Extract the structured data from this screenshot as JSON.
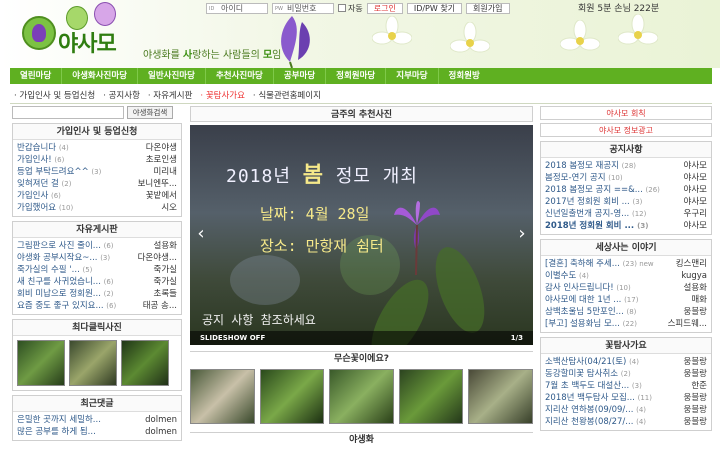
{
  "header": {
    "logo": "야사모",
    "tagline_parts": [
      "야생화를 ",
      "사",
      "랑하는 사람들의 ",
      "모",
      "임"
    ],
    "login": {
      "id_tag": "ID",
      "id_placeholder": "아이디",
      "pw_tag": "PW",
      "pw_placeholder": "비밀번호",
      "auto_label": "자동",
      "login_btn": "로그인",
      "find_btn": "ID/PW 찾기",
      "join_btn": "회원가입"
    },
    "stats": "회원 5분  손님 222분"
  },
  "nav": [
    "열린마당",
    "야생화사진마당",
    "일반사진마당",
    "추천사진마당",
    "공부마당",
    "정회원마당",
    "지부마당",
    "정회원방"
  ],
  "subnav": [
    "가입인사 및 등업신청",
    "공지사항",
    "자유게시판",
    "꽃탐사가요",
    "식물관련홈페이지"
  ],
  "search_btn": "야생화검색",
  "left": {
    "greeting": {
      "title": "가입인사 및 등업신청",
      "rows": [
        {
          "t": "반갑습니다",
          "c": "(4)",
          "a": "다온야생"
        },
        {
          "t": "가입인사!",
          "c": "(6)",
          "a": "초로인생"
        },
        {
          "t": "등업 부탁드려요^^",
          "c": "(3)",
          "a": "미리내"
        },
        {
          "t": "잊혀져던 걸",
          "c": "(2)",
          "a": "보니엔뚜..."
        },
        {
          "t": "가입인사",
          "c": "(6)",
          "a": "꽃밭에서"
        },
        {
          "t": "가입했어요",
          "c": "(10)",
          "a": "시오"
        }
      ]
    },
    "free": {
      "title": "자유게시판",
      "rows": [
        {
          "t": "그림판으로 사진 줄이...",
          "c": "(6)",
          "a": "설용화"
        },
        {
          "t": "야생화 공부시작요~...",
          "c": "(3)",
          "a": "다온야생..."
        },
        {
          "t": "죽가실의 수필 '...",
          "c": "(5)",
          "a": "죽가실"
        },
        {
          "t": "새 친구를 사귀었습니...",
          "c": "(6)",
          "a": "죽가실"
        },
        {
          "t": "회비 미납으로 정회원...",
          "c": "(2)",
          "a": "초록들"
        },
        {
          "t": "요즘 중도 좋구 있지요...",
          "c": "(6)",
          "a": "태공 송..."
        }
      ]
    },
    "top_click": {
      "title": "최다클릭사진"
    },
    "recent": {
      "title": "최근댓글",
      "rows": [
        {
          "t": "은밀한 곳까지 세밀하...",
          "a": "dolmen"
        },
        {
          "t": "많은 공부를 하게 됩...",
          "a": "dolmen"
        }
      ]
    }
  },
  "center": {
    "weekly_title": "금주의 추천사진",
    "slide": {
      "line1_pre": "2018년 ",
      "line1_big": "봄",
      "line1_post": " 정모 개최",
      "line2": "날짜: 4월 28일",
      "line3": "장소: 만항재 쉼터",
      "line4": "공지 사항 참조하세요",
      "bar_left": "SLIDESHOW OFF",
      "bar_right": "1/3",
      "prev": "‹",
      "next": "›"
    },
    "quiz_title": "무슨꽃이에요?",
    "wildflower_title": "야생화"
  },
  "right": {
    "btn1": "야사모 회칙",
    "btn2": "야사모 정보광고",
    "notice": {
      "title": "공지사항",
      "rows": [
        {
          "t": "2018 봄정모 재공지",
          "c": "(28)",
          "a": "야사모"
        },
        {
          "t": "봄정모-연기 공지",
          "c": "(10)",
          "a": "야사모"
        },
        {
          "t": "2018 봄정모 공지 ==&...",
          "c": "(26)",
          "a": "야사모"
        },
        {
          "t": "2017년 정회원 회비 ...",
          "c": "(3)",
          "a": "야사모"
        },
        {
          "t": "신년일출번개 공지-영...",
          "c": "(12)",
          "a": "우구리"
        },
        {
          "t": "2018년 정회원 회비 ...",
          "c": "(3)",
          "a": "야사모"
        }
      ]
    },
    "world": {
      "title": "세상사는 이야기",
      "rows": [
        {
          "t": "[결혼] 축하해 주세...",
          "c": "(23) new",
          "a": "킹스맨리"
        },
        {
          "t": "이별수도",
          "c": "(4)",
          "a": "kugya"
        },
        {
          "t": "감사 인사드립니다!",
          "c": "(10)",
          "a": "설용화"
        },
        {
          "t": "야사모에 대한 1년 ...",
          "c": "(17)",
          "a": "매화"
        },
        {
          "t": "삼백초울님 5만포인...",
          "c": "(8)",
          "a": "웅블랑"
        },
        {
          "t": "[부고] 설용화님 모...",
          "c": "(22)",
          "a": "스피드웨..."
        }
      ]
    },
    "explore": {
      "title": "꽃탐사가요",
      "rows": [
        {
          "t": "소백산탐사(04/21(토)",
          "c": "(4)",
          "a": "웅블랑"
        },
        {
          "t": "동강할미꽃 탐사취소",
          "c": "(2)",
          "a": "웅블랑"
        },
        {
          "t": "7월 초 백두도 대설산...",
          "c": "(3)",
          "a": "한준"
        },
        {
          "t": "2018년 백두탐사 모집...",
          "c": "(11)",
          "a": "웅블랑"
        },
        {
          "t": "지리산 연하봉(09/09/...",
          "c": "(4)",
          "a": "웅블랑"
        },
        {
          "t": "지리산 천왕봉(08/27/...",
          "c": "(4)",
          "a": "웅블랑"
        }
      ]
    }
  },
  "colors": {
    "nav_green": "#5fb021",
    "logo_green": "#2f7d10",
    "accent_red": "#e33",
    "link_blue": "#2f5a8a"
  }
}
